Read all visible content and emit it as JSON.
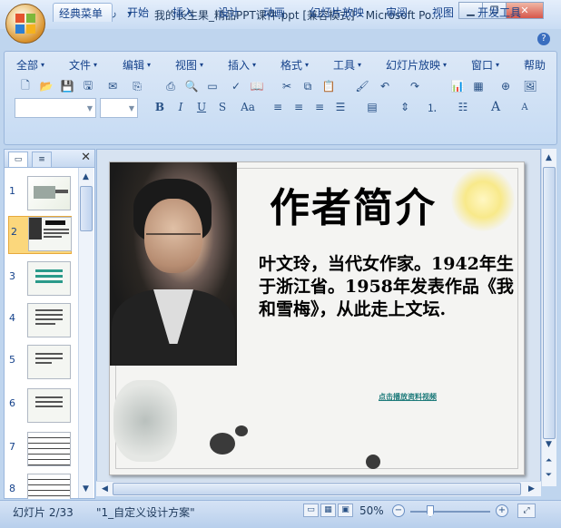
{
  "window": {
    "title": "我的长生果_精品PPT课件.ppt [兼容模式] - Microsoft Po...",
    "minimize": "▁",
    "restore": "❐",
    "close": "✕"
  },
  "quick_access": {
    "save": "💾",
    "undo": "↶",
    "redo": "↻",
    "customize": "▾"
  },
  "ribbon_tabs": [
    {
      "label": "经典菜单",
      "active": true
    },
    {
      "label": "开始"
    },
    {
      "label": "插入"
    },
    {
      "label": "设计"
    },
    {
      "label": "动画"
    },
    {
      "label": "幻灯片放映"
    },
    {
      "label": "审阅"
    },
    {
      "label": "视图"
    },
    {
      "label": "开发工具"
    }
  ],
  "help_icon": "?",
  "menus": [
    "全部",
    "文件",
    "编辑",
    "视图",
    "插入",
    "格式",
    "工具",
    "幻灯片放映",
    "窗口",
    "帮助"
  ],
  "toolbar": {
    "bold": "B",
    "italic": "I",
    "underline": "U",
    "shadow": "S",
    "change_case": "Aa",
    "font_size_grow": "A",
    "font_size_shrink": "A"
  },
  "slide_panel": {
    "close": "✕",
    "thumbs": [
      {
        "num": "1"
      },
      {
        "num": "2",
        "selected": true
      },
      {
        "num": "3"
      },
      {
        "num": "4"
      },
      {
        "num": "5"
      },
      {
        "num": "6"
      },
      {
        "num": "7"
      },
      {
        "num": "8"
      }
    ]
  },
  "slide": {
    "title": "作者简介",
    "body": "叶文玲，当代女作家。1942年生于浙江省。1958年发表作品《我和雪梅》，从此走上文坛.",
    "link": "点击播放资料视频"
  },
  "status": {
    "slide_counter": "幻灯片 2/33",
    "theme": "\"1_自定义设计方案\"",
    "zoom": "50%",
    "zoom_level": 0.5,
    "zoom_out": "−",
    "zoom_in": "+"
  },
  "colors": {
    "ribbon_bg": "#c6dbf3",
    "selected_thumb": "#fbd77c",
    "link": "#1e7b7b"
  }
}
